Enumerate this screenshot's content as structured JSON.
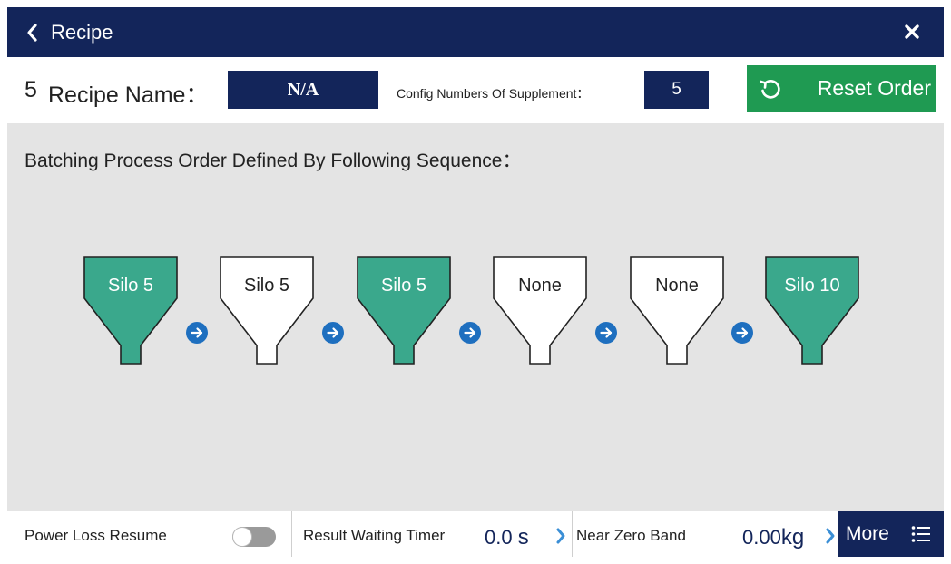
{
  "header": {
    "title": "Recipe",
    "back_icon": "chevron-left-icon",
    "close_icon": "close-icon"
  },
  "info": {
    "recipe_number": "5",
    "recipe_name_label": "Recipe Name：",
    "recipe_name_value": "N/A",
    "config_label": "Config Numbers Of Supplement：",
    "config_value": "5",
    "reset_label": "Reset Order",
    "reset_icon": "reset-icon"
  },
  "main": {
    "title": "Batching Process Order Defined By Following Sequence：",
    "sequence": [
      {
        "label": "Silo 5",
        "filled": true
      },
      {
        "label": "Silo 5",
        "filled": false
      },
      {
        "label": "Silo 5",
        "filled": true
      },
      {
        "label": "None",
        "filled": false
      },
      {
        "label": "None",
        "filled": false
      },
      {
        "label": "Silo 10",
        "filled": true
      }
    ],
    "arrow_icon": "arrow-right-circle-icon"
  },
  "footer": {
    "power_loss_label": "Power Loss Resume",
    "power_loss_on": false,
    "result_timer_label": "Result Waiting Timer",
    "result_timer_value": "0.0",
    "result_timer_unit": "s",
    "near_zero_label": "Near Zero Band",
    "near_zero_value": "0.00",
    "near_zero_unit": "kg",
    "more_label": "More",
    "more_icon": "list-icon"
  },
  "colors": {
    "navy": "#13255a",
    "green": "#1f9a52",
    "silo_fill": "#3aa88c",
    "arrow_blue": "#1e6fbf",
    "background": "#e4e4e4"
  }
}
